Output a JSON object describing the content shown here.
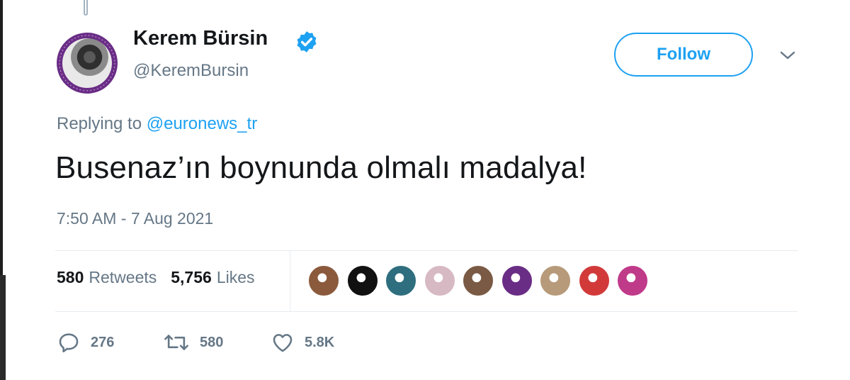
{
  "tweet": {
    "author": {
      "display_name": "Kerem Bürsin",
      "handle": "@KeremBursin",
      "verified_icon": "verified-badge-icon",
      "avatar_icon": "profile-avatar"
    },
    "follow_label": "Follow",
    "menu_icon": "chevron-down-icon",
    "reply_prefix": "Replying to",
    "reply_to": "@euronews_tr",
    "text": "Busenaz’ın boynunda olmalı madalya!",
    "timestamp": "7:50 AM - 7 Aug 2021",
    "stats": {
      "retweets_count": "580",
      "retweets_label": "Retweets",
      "likes_count": "5,756",
      "likes_label": "Likes"
    },
    "likers": [
      {
        "name": "liker-avatar-1",
        "color": "#8b5a3c"
      },
      {
        "name": "liker-avatar-2",
        "color": "#111111"
      },
      {
        "name": "liker-avatar-3",
        "color": "#2e6e7e"
      },
      {
        "name": "liker-avatar-4",
        "color": "#d7b9c3"
      },
      {
        "name": "liker-avatar-5",
        "color": "#7a5a44"
      },
      {
        "name": "liker-avatar-6",
        "color": "#6a2d86"
      },
      {
        "name": "liker-avatar-7",
        "color": "#b79a7a"
      },
      {
        "name": "liker-avatar-8",
        "color": "#d23a3a"
      },
      {
        "name": "liker-avatar-9",
        "color": "#c03a8a"
      }
    ],
    "actions": {
      "reply_count": "276",
      "retweet_count": "580",
      "like_count": "5.8K"
    }
  },
  "colors": {
    "accent": "#1da1f2",
    "text_primary": "#14171a",
    "text_secondary": "#657786",
    "divider": "#e6ecf0"
  }
}
